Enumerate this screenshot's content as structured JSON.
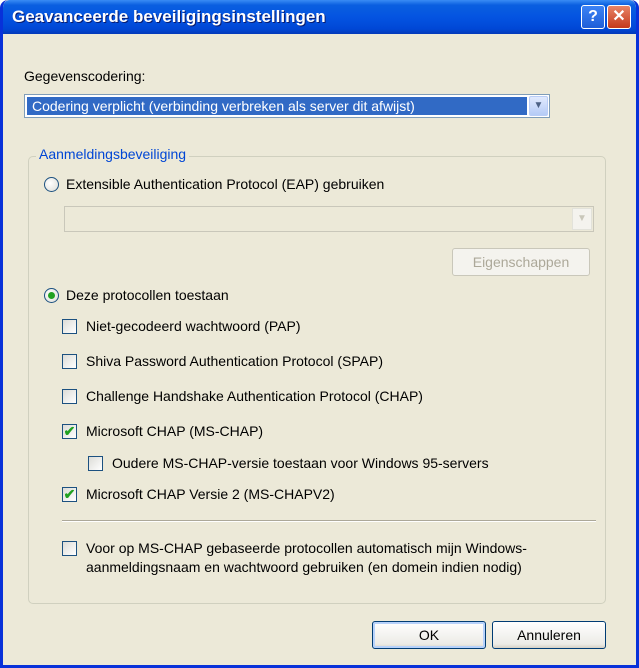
{
  "window": {
    "title": "Geavanceerde beveiligingsinstellingen",
    "help_glyph": "?",
    "close_glyph": "✕"
  },
  "encryption": {
    "label": "Gegevenscodering:",
    "selected": "Codering verplicht (verbinding verbreken als server dit afwijst)",
    "arrow_glyph": "▼"
  },
  "logon": {
    "group_label": "Aanmeldingsbeveiliging",
    "eap_radio": {
      "label": "Extensible Authentication Protocol (EAP) gebruiken",
      "selected": false
    },
    "eap_combo_value": "",
    "eap_combo_arrow": "▼",
    "properties_button": "Eigenschappen",
    "allow_radio": {
      "label": "Deze protocollen toestaan",
      "selected": true
    },
    "protocols": [
      {
        "label": "Niet-gecodeerd wachtwoord (PAP)",
        "checked": false
      },
      {
        "label": "Shiva Password Authentication Protocol (SPAP)",
        "checked": false
      },
      {
        "label": "Challenge Handshake Authentication Protocol (CHAP)",
        "checked": false
      },
      {
        "label": "Microsoft CHAP (MS-CHAP)",
        "checked": true
      },
      {
        "label": "Oudere MS-CHAP-versie toestaan voor Windows 95-servers",
        "checked": false
      },
      {
        "label": "Microsoft CHAP Versie 2 (MS-CHAPV2)",
        "checked": true
      }
    ],
    "auto_logon": {
      "line1": "Voor op MS-CHAP gebaseerde protocollen automatisch mijn Windows-",
      "line2": "aanmeldingsnaam en wachtwoord gebruiken (en domein indien nodig)",
      "checked": false
    },
    "check_glyph": "✔"
  },
  "buttons": {
    "ok": "OK",
    "cancel": "Annuleren"
  },
  "colors": {
    "title_bar": "#0454e1",
    "group_label": "#0046d5",
    "selection": "#316ac5",
    "check": "#21a121"
  }
}
